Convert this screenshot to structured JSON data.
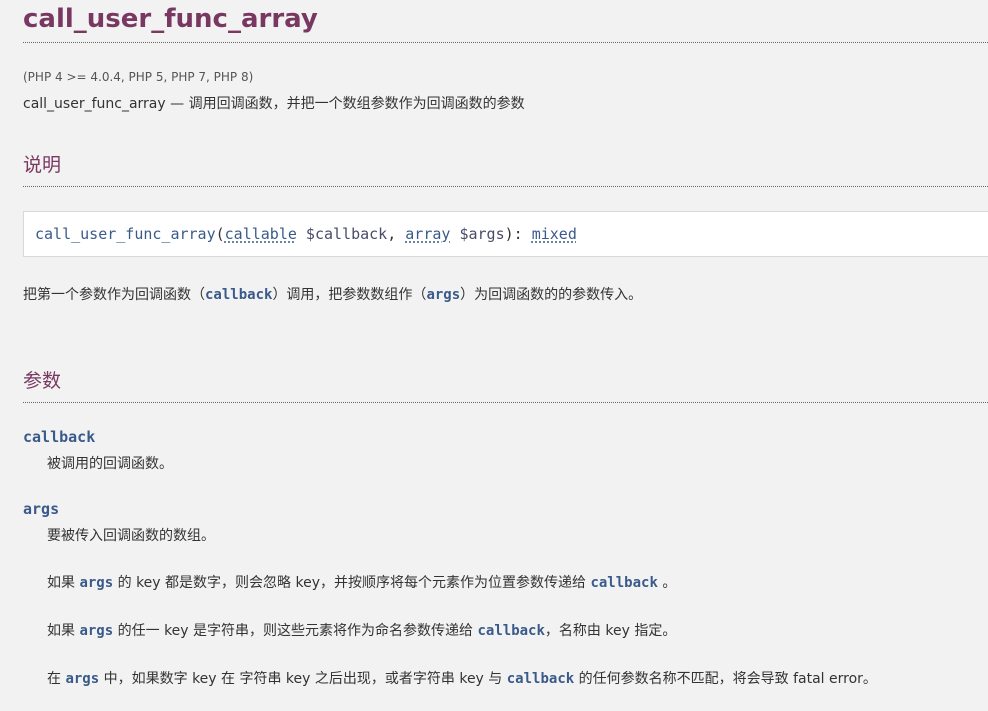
{
  "header": {
    "function_name": "call_user_func_array",
    "version_info": "(PHP 4 >= 4.0.4, PHP 5, PHP 7, PHP 8)",
    "purpose": "call_user_func_array — 调用回调函数，并把一个数组参数作为回调函数的参数"
  },
  "description": {
    "title": "说明",
    "synopsis": {
      "name": "call_user_func_array",
      "open_paren": "(",
      "param1_type": "callable",
      "param1_name": " $callback",
      "comma": ", ",
      "param2_type": "array",
      "param2_name": " $args",
      "close": "): ",
      "return_type": "mixed"
    },
    "text": {
      "part1": "把第一个参数作为回调函数（",
      "code1": "callback",
      "part2": "）调用，把参数数组作（",
      "code2": "args",
      "part3": "）为回调函数的的参数传入。"
    }
  },
  "parameters": {
    "title": "参数",
    "callback": {
      "term": "callback",
      "desc": "被调用的回调函数。"
    },
    "args": {
      "term": "args",
      "desc": "要被传入回调函数的数组。",
      "note1": {
        "a": "如果 ",
        "code1": "args",
        "b": " 的 key 都是数字，则会忽略 key，并按顺序将每个元素作为位置参数传递给 ",
        "code2": "callback",
        "c": " 。"
      },
      "note2": {
        "a": "如果 ",
        "code1": "args",
        "b": " 的任一 key 是字符串，则这些元素将作为命名参数传递给 ",
        "code2": "callback",
        "c": "，名称由 key 指定。"
      },
      "note3": {
        "a": "在 ",
        "code1": "args",
        "b": " 中，如果数字 key 在 字符串 key 之后出现，或者字符串 key 与 ",
        "code2": "callback",
        "c": " 的任何参数名称不匹配，将会导致 fatal error。"
      }
    }
  },
  "colors": {
    "heading": "#793862",
    "code": "#3a5a8a",
    "background": "#f2f2f2"
  }
}
